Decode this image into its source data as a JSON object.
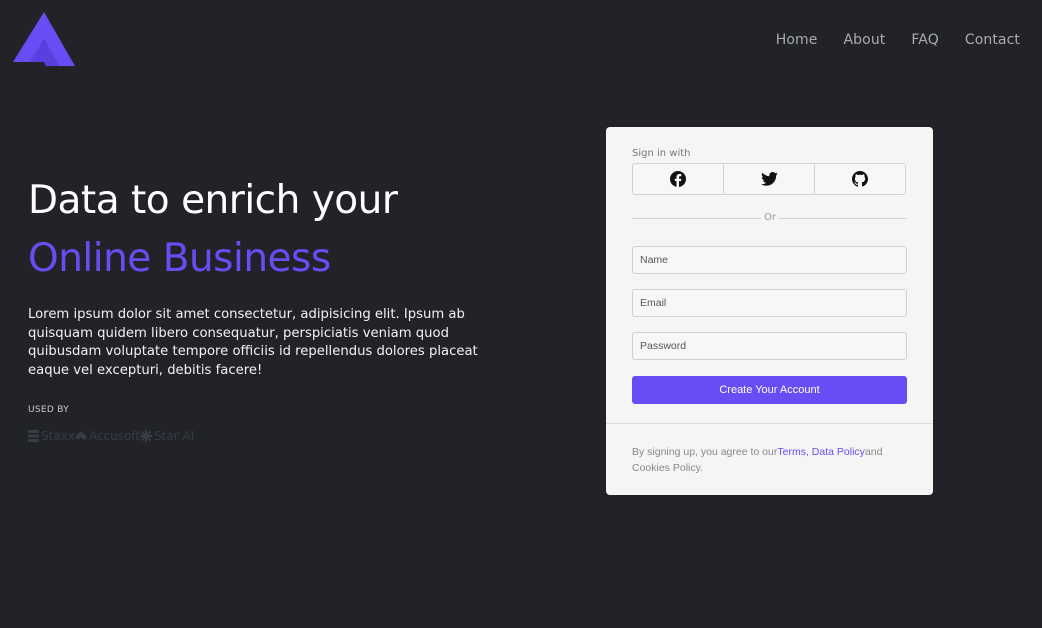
{
  "brand": {
    "logo_icon": "triangle-a-logo",
    "accent_color": "#6a4cf5",
    "background": "#212328"
  },
  "nav": {
    "items": [
      "Home",
      "About",
      "FAQ",
      "Contact"
    ]
  },
  "hero": {
    "title_line1": "Data to enrich your",
    "title_line2": "Online Business",
    "description": "Lorem ipsum dolor sit amet consectetur, adipisicing elit. Ipsum ab quisquam quidem libero consequatur, perspiciatis veniam quod quibusdam voluptate tempore officiis id repellendus dolores placeat eaque vel excepturi, debitis facere!",
    "used_by_label": "USED BY",
    "brands": [
      {
        "name": "Staxx",
        "icon": "stack-icon"
      },
      {
        "name": "Accusoft",
        "icon": "diamond-icon"
      },
      {
        "name": "Star AI",
        "icon": "asterisk-icon"
      }
    ]
  },
  "form": {
    "signin_label": "Sign in with",
    "social": [
      {
        "name": "facebook",
        "icon": "facebook-icon"
      },
      {
        "name": "twitter",
        "icon": "twitter-icon"
      },
      {
        "name": "github",
        "icon": "github-icon"
      }
    ],
    "or_label": "Or",
    "name_placeholder": "Name",
    "email_placeholder": "Email",
    "password_placeholder": "Password",
    "submit_label": "Create Your Account",
    "terms_prefix": "By signing up, you agree to our",
    "terms_link": "Terms",
    "terms_sep": ", ",
    "data_policy_link": "Data Policy",
    "terms_suffix": "and Cookies Policy."
  }
}
